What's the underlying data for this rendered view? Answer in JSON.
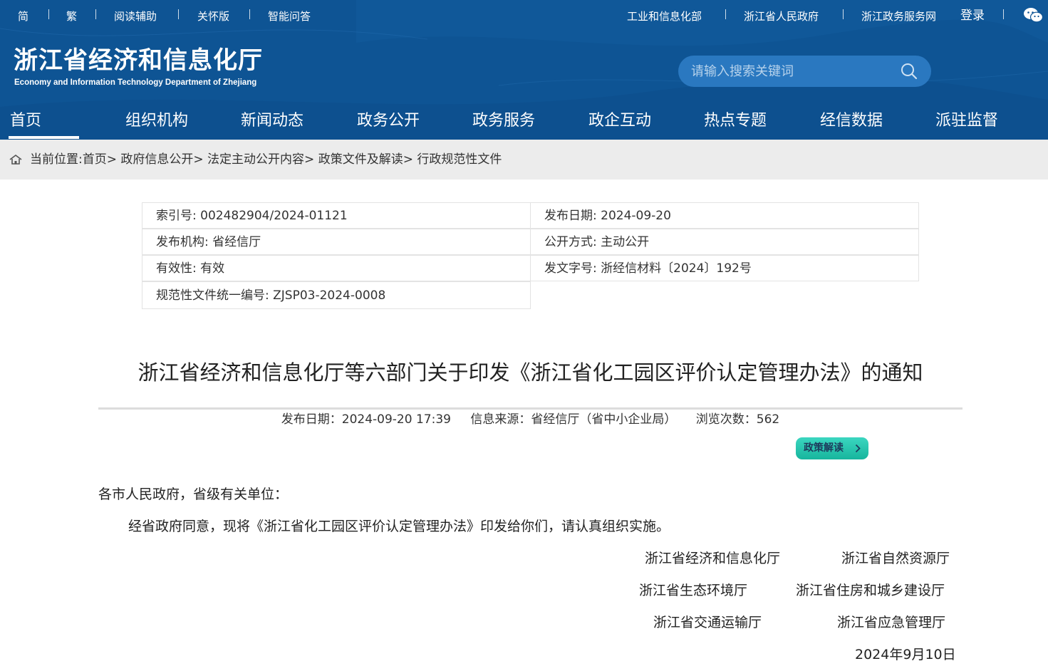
{
  "topbar": {
    "left_links": [
      "简",
      "繁",
      "阅读辅助",
      "关怀版",
      "智能问答"
    ],
    "right_links": [
      "工业和信息化部",
      "浙江省人民政府",
      "浙江政务服务网",
      "登录"
    ]
  },
  "header": {
    "logo_cn": "浙江省经济和信息化厅",
    "logo_en": "Economy and Information Technology Department of Zhejiang",
    "search_placeholder": "请输入搜索关键词"
  },
  "nav": {
    "items": [
      "首页",
      "组织机构",
      "新闻动态",
      "政务公开",
      "政务服务",
      "政企互动",
      "热点专题",
      "经信数据",
      "派驻监督"
    ],
    "active": "首页"
  },
  "breadcrumb": {
    "prefix": "当前位置:",
    "items": [
      "首页",
      "政府信息公开",
      "法定主动公开内容",
      "政策文件及解读",
      "行政规范性文件"
    ]
  },
  "info": {
    "index_no": "索引号: 002482904/2024-01121",
    "publish_date": "发布日期: 2024-09-20",
    "publisher": "发布机构: 省经信厅",
    "open_mode": "公开方式: 主动公开",
    "validity": "有效性: 有效",
    "doc_no": "发文字号: 浙经信材料〔2024〕192号",
    "unified_no": "规范性文件统一编号: ZJSP03-2024-0008"
  },
  "article": {
    "title": "浙江省经济和信息化厅等六部门关于印发《浙江省化工园区评价认定管理办法》的通知",
    "meta_date": "发布日期：2024-09-20 17:39",
    "meta_source": "信息来源：省经信厅（省中小企业局）",
    "meta_views": "浏览次数：562",
    "policy_button": "政策解读",
    "salutation": "各市人民政府，省级有关单位：",
    "body": "经省政府同意，现将《浙江省化工园区评价认定管理办法》印发给你们，请认真组织实施。",
    "signers": [
      "浙江省经济和信息化厅",
      "浙江省自然资源厅",
      "浙江省生态环境厅",
      "浙江省住房和城乡建设厅",
      "浙江省交通运输厅",
      "浙江省应急管理厅"
    ],
    "sign_date": "2024年9月10日"
  },
  "colors": {
    "header_blue": "#0e5494",
    "search_bg": "#2a78c0",
    "crumb_bg": "#ececec",
    "policy_btn": "#1fc3aa"
  },
  "icons": [
    "wechat-icon",
    "search-icon",
    "home-icon",
    "chevron-right-icon"
  ]
}
